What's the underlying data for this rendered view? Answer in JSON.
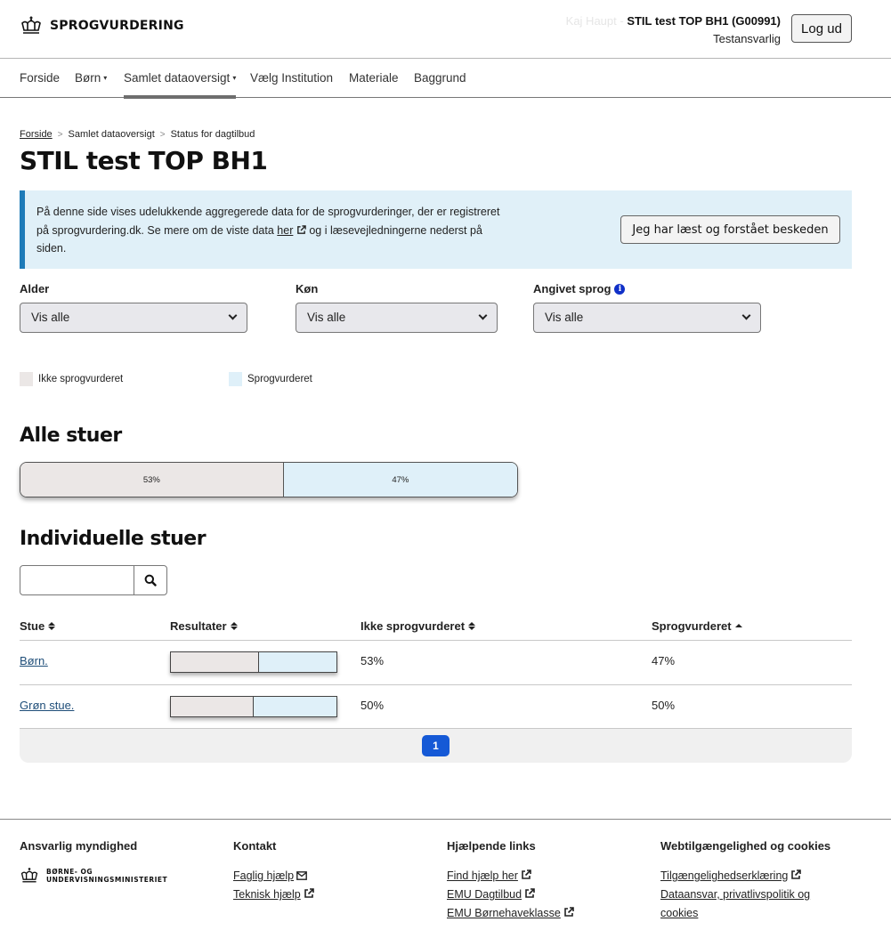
{
  "header": {
    "logo_text": "SPROGVURDERING",
    "user_name": "Kaj Haupt - ",
    "institution": "STIL test TOP BH1 (G00991)",
    "role": "Testansvarlig",
    "logout_label": "Log ud"
  },
  "nav": {
    "items": [
      {
        "label": "Forside",
        "dropdown": false,
        "active": false
      },
      {
        "label": "Børn",
        "dropdown": true,
        "active": false
      },
      {
        "label": "Samlet dataoversigt",
        "dropdown": true,
        "active": true
      },
      {
        "label": "Vælg Institution",
        "dropdown": false,
        "active": false
      },
      {
        "label": "Materiale",
        "dropdown": false,
        "active": false
      },
      {
        "label": "Baggrund",
        "dropdown": false,
        "active": false
      }
    ]
  },
  "breadcrumb": {
    "items": [
      "Forside",
      "Samlet dataoversigt",
      "Status for dagtilbud"
    ]
  },
  "page_title": "STIL test TOP BH1",
  "info_box": {
    "text_before_link": "På denne side vises udelukkende aggregerede data for de sprogvurderinger, der er registreret på sprogvurdering.dk. Se mere om de viste data ",
    "link_text": "her",
    "text_after_link": " og i læsevejledningerne nederst på siden.",
    "ack_button": "Jeg har læst og forstået beskeden"
  },
  "filters": [
    {
      "label": "Alder",
      "value": "Vis alle",
      "info": false
    },
    {
      "label": "Køn",
      "value": "Vis alle",
      "info": false
    },
    {
      "label": "Angivet sprog",
      "value": "Vis alle",
      "info": true
    }
  ],
  "legend": [
    {
      "label": "Ikke sprogvurderet",
      "color": "#ebe7e6"
    },
    {
      "label": "Sprogvurderet",
      "color": "#dff0f9"
    }
  ],
  "all_rooms": {
    "title": "Alle stuer",
    "not_assessed_pct": 53,
    "assessed_pct": 47,
    "not_assessed_label": "53%",
    "assessed_label": "47%"
  },
  "individual_rooms": {
    "title": "Individuelle stuer",
    "search_value": "",
    "columns": [
      "Stue",
      "Resultater",
      "Ikke sprogvurderet",
      "Sprogvurderet"
    ],
    "sort_state": [
      "both",
      "both",
      "both",
      "asc"
    ],
    "rows": [
      {
        "name": "Børn.",
        "not_assessed_pct": 53,
        "assessed_pct": 47,
        "not_assessed": "53%",
        "assessed": "47%"
      },
      {
        "name": "Grøn stue.",
        "not_assessed_pct": 50,
        "assessed_pct": 50,
        "not_assessed": "50%",
        "assessed": "50%"
      }
    ],
    "current_page": "1"
  },
  "colors": {
    "accent_blue": "#1559d6",
    "info_border": "#1e7bb8",
    "info_bg": "#e0f0f8",
    "not_assessed": "#ebe7e6",
    "assessed": "#dff0f9",
    "link": "#1f4e79"
  },
  "footer": {
    "columns": [
      {
        "heading": "Ansvarlig myndighed",
        "ministry_line1": "BØRNE- OG",
        "ministry_line2": "UNDERVISNINGSMINISTERIET"
      },
      {
        "heading": "Kontakt",
        "links": [
          {
            "label": "Faglig hjælp",
            "icon": "mail-icon"
          },
          {
            "label": "Teknisk hjælp",
            "icon": "external-link-icon"
          }
        ]
      },
      {
        "heading": "Hjælpende links",
        "links": [
          {
            "label": "Find hjælp her",
            "icon": "external-link-icon"
          },
          {
            "label": "EMU Dagtilbud",
            "icon": "external-link-icon"
          },
          {
            "label": "EMU Børnehaveklasse",
            "icon": "external-link-icon"
          }
        ]
      },
      {
        "heading": "Webtilgængelighed og cookies",
        "links": [
          {
            "label": "Tilgængelighedserklæring",
            "icon": "external-link-icon"
          },
          {
            "label": "Dataansvar, privatlivspolitik og cookies",
            "icon": ""
          }
        ]
      }
    ]
  }
}
